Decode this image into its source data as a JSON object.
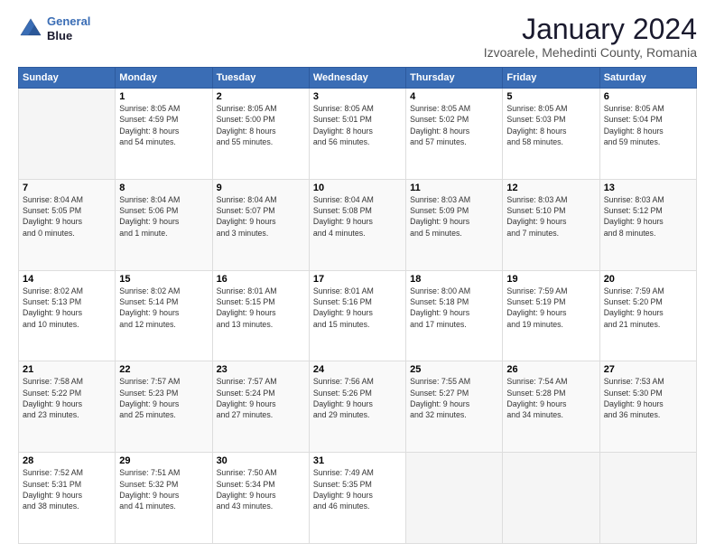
{
  "header": {
    "logo_line1": "General",
    "logo_line2": "Blue",
    "month_title": "January 2024",
    "location": "Izvoarele, Mehedinti County, Romania"
  },
  "days_of_week": [
    "Sunday",
    "Monday",
    "Tuesday",
    "Wednesday",
    "Thursday",
    "Friday",
    "Saturday"
  ],
  "weeks": [
    [
      {
        "day": "",
        "info": ""
      },
      {
        "day": "1",
        "info": "Sunrise: 8:05 AM\nSunset: 4:59 PM\nDaylight: 8 hours\nand 54 minutes."
      },
      {
        "day": "2",
        "info": "Sunrise: 8:05 AM\nSunset: 5:00 PM\nDaylight: 8 hours\nand 55 minutes."
      },
      {
        "day": "3",
        "info": "Sunrise: 8:05 AM\nSunset: 5:01 PM\nDaylight: 8 hours\nand 56 minutes."
      },
      {
        "day": "4",
        "info": "Sunrise: 8:05 AM\nSunset: 5:02 PM\nDaylight: 8 hours\nand 57 minutes."
      },
      {
        "day": "5",
        "info": "Sunrise: 8:05 AM\nSunset: 5:03 PM\nDaylight: 8 hours\nand 58 minutes."
      },
      {
        "day": "6",
        "info": "Sunrise: 8:05 AM\nSunset: 5:04 PM\nDaylight: 8 hours\nand 59 minutes."
      }
    ],
    [
      {
        "day": "7",
        "info": "Sunrise: 8:04 AM\nSunset: 5:05 PM\nDaylight: 9 hours\nand 0 minutes."
      },
      {
        "day": "8",
        "info": "Sunrise: 8:04 AM\nSunset: 5:06 PM\nDaylight: 9 hours\nand 1 minute."
      },
      {
        "day": "9",
        "info": "Sunrise: 8:04 AM\nSunset: 5:07 PM\nDaylight: 9 hours\nand 3 minutes."
      },
      {
        "day": "10",
        "info": "Sunrise: 8:04 AM\nSunset: 5:08 PM\nDaylight: 9 hours\nand 4 minutes."
      },
      {
        "day": "11",
        "info": "Sunrise: 8:03 AM\nSunset: 5:09 PM\nDaylight: 9 hours\nand 5 minutes."
      },
      {
        "day": "12",
        "info": "Sunrise: 8:03 AM\nSunset: 5:10 PM\nDaylight: 9 hours\nand 7 minutes."
      },
      {
        "day": "13",
        "info": "Sunrise: 8:03 AM\nSunset: 5:12 PM\nDaylight: 9 hours\nand 8 minutes."
      }
    ],
    [
      {
        "day": "14",
        "info": "Sunrise: 8:02 AM\nSunset: 5:13 PM\nDaylight: 9 hours\nand 10 minutes."
      },
      {
        "day": "15",
        "info": "Sunrise: 8:02 AM\nSunset: 5:14 PM\nDaylight: 9 hours\nand 12 minutes."
      },
      {
        "day": "16",
        "info": "Sunrise: 8:01 AM\nSunset: 5:15 PM\nDaylight: 9 hours\nand 13 minutes."
      },
      {
        "day": "17",
        "info": "Sunrise: 8:01 AM\nSunset: 5:16 PM\nDaylight: 9 hours\nand 15 minutes."
      },
      {
        "day": "18",
        "info": "Sunrise: 8:00 AM\nSunset: 5:18 PM\nDaylight: 9 hours\nand 17 minutes."
      },
      {
        "day": "19",
        "info": "Sunrise: 7:59 AM\nSunset: 5:19 PM\nDaylight: 9 hours\nand 19 minutes."
      },
      {
        "day": "20",
        "info": "Sunrise: 7:59 AM\nSunset: 5:20 PM\nDaylight: 9 hours\nand 21 minutes."
      }
    ],
    [
      {
        "day": "21",
        "info": "Sunrise: 7:58 AM\nSunset: 5:22 PM\nDaylight: 9 hours\nand 23 minutes."
      },
      {
        "day": "22",
        "info": "Sunrise: 7:57 AM\nSunset: 5:23 PM\nDaylight: 9 hours\nand 25 minutes."
      },
      {
        "day": "23",
        "info": "Sunrise: 7:57 AM\nSunset: 5:24 PM\nDaylight: 9 hours\nand 27 minutes."
      },
      {
        "day": "24",
        "info": "Sunrise: 7:56 AM\nSunset: 5:26 PM\nDaylight: 9 hours\nand 29 minutes."
      },
      {
        "day": "25",
        "info": "Sunrise: 7:55 AM\nSunset: 5:27 PM\nDaylight: 9 hours\nand 32 minutes."
      },
      {
        "day": "26",
        "info": "Sunrise: 7:54 AM\nSunset: 5:28 PM\nDaylight: 9 hours\nand 34 minutes."
      },
      {
        "day": "27",
        "info": "Sunrise: 7:53 AM\nSunset: 5:30 PM\nDaylight: 9 hours\nand 36 minutes."
      }
    ],
    [
      {
        "day": "28",
        "info": "Sunrise: 7:52 AM\nSunset: 5:31 PM\nDaylight: 9 hours\nand 38 minutes."
      },
      {
        "day": "29",
        "info": "Sunrise: 7:51 AM\nSunset: 5:32 PM\nDaylight: 9 hours\nand 41 minutes."
      },
      {
        "day": "30",
        "info": "Sunrise: 7:50 AM\nSunset: 5:34 PM\nDaylight: 9 hours\nand 43 minutes."
      },
      {
        "day": "31",
        "info": "Sunrise: 7:49 AM\nSunset: 5:35 PM\nDaylight: 9 hours\nand 46 minutes."
      },
      {
        "day": "",
        "info": ""
      },
      {
        "day": "",
        "info": ""
      },
      {
        "day": "",
        "info": ""
      }
    ]
  ]
}
